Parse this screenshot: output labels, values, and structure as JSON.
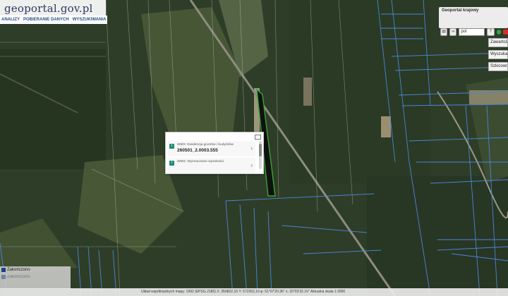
{
  "logo": {
    "title": "geoportal.gov.pl"
  },
  "menu": [
    "ANALIZY",
    "POBIERANIE DANYCH",
    "WYSZUKIWANIA"
  ],
  "right_panel": {
    "title": "Geoportal krajowy",
    "language": "pol",
    "buttons": [
      "Zawartość",
      "Wyszukaj",
      "Szkicownik"
    ]
  },
  "popup": {
    "rows": [
      {
        "label": "WMS: Ewidencja gruntów i budynków",
        "value": "260501_2.0003.555"
      },
      {
        "label": "WMS: Wyznaczanie wysokości",
        "value": ""
      }
    ]
  },
  "legend": {
    "items": [
      "Zakończono",
      "Zakończono"
    ]
  },
  "status": {
    "text": "Układ współrzędnych mapy: 1992 (EPSG 2180)    X: 359822,15  Y: 572262,10    φ: 51°07'20.36\"  λ: 20°03'32.19\"    Aktualna skala 1:3000"
  },
  "colors": {
    "forest_dark": "#283a22",
    "clearing": "#5f6f4a",
    "parcel_line": "#4a86d9",
    "highlight_parcel": "#111111",
    "highlight_outline": "#39a535"
  }
}
